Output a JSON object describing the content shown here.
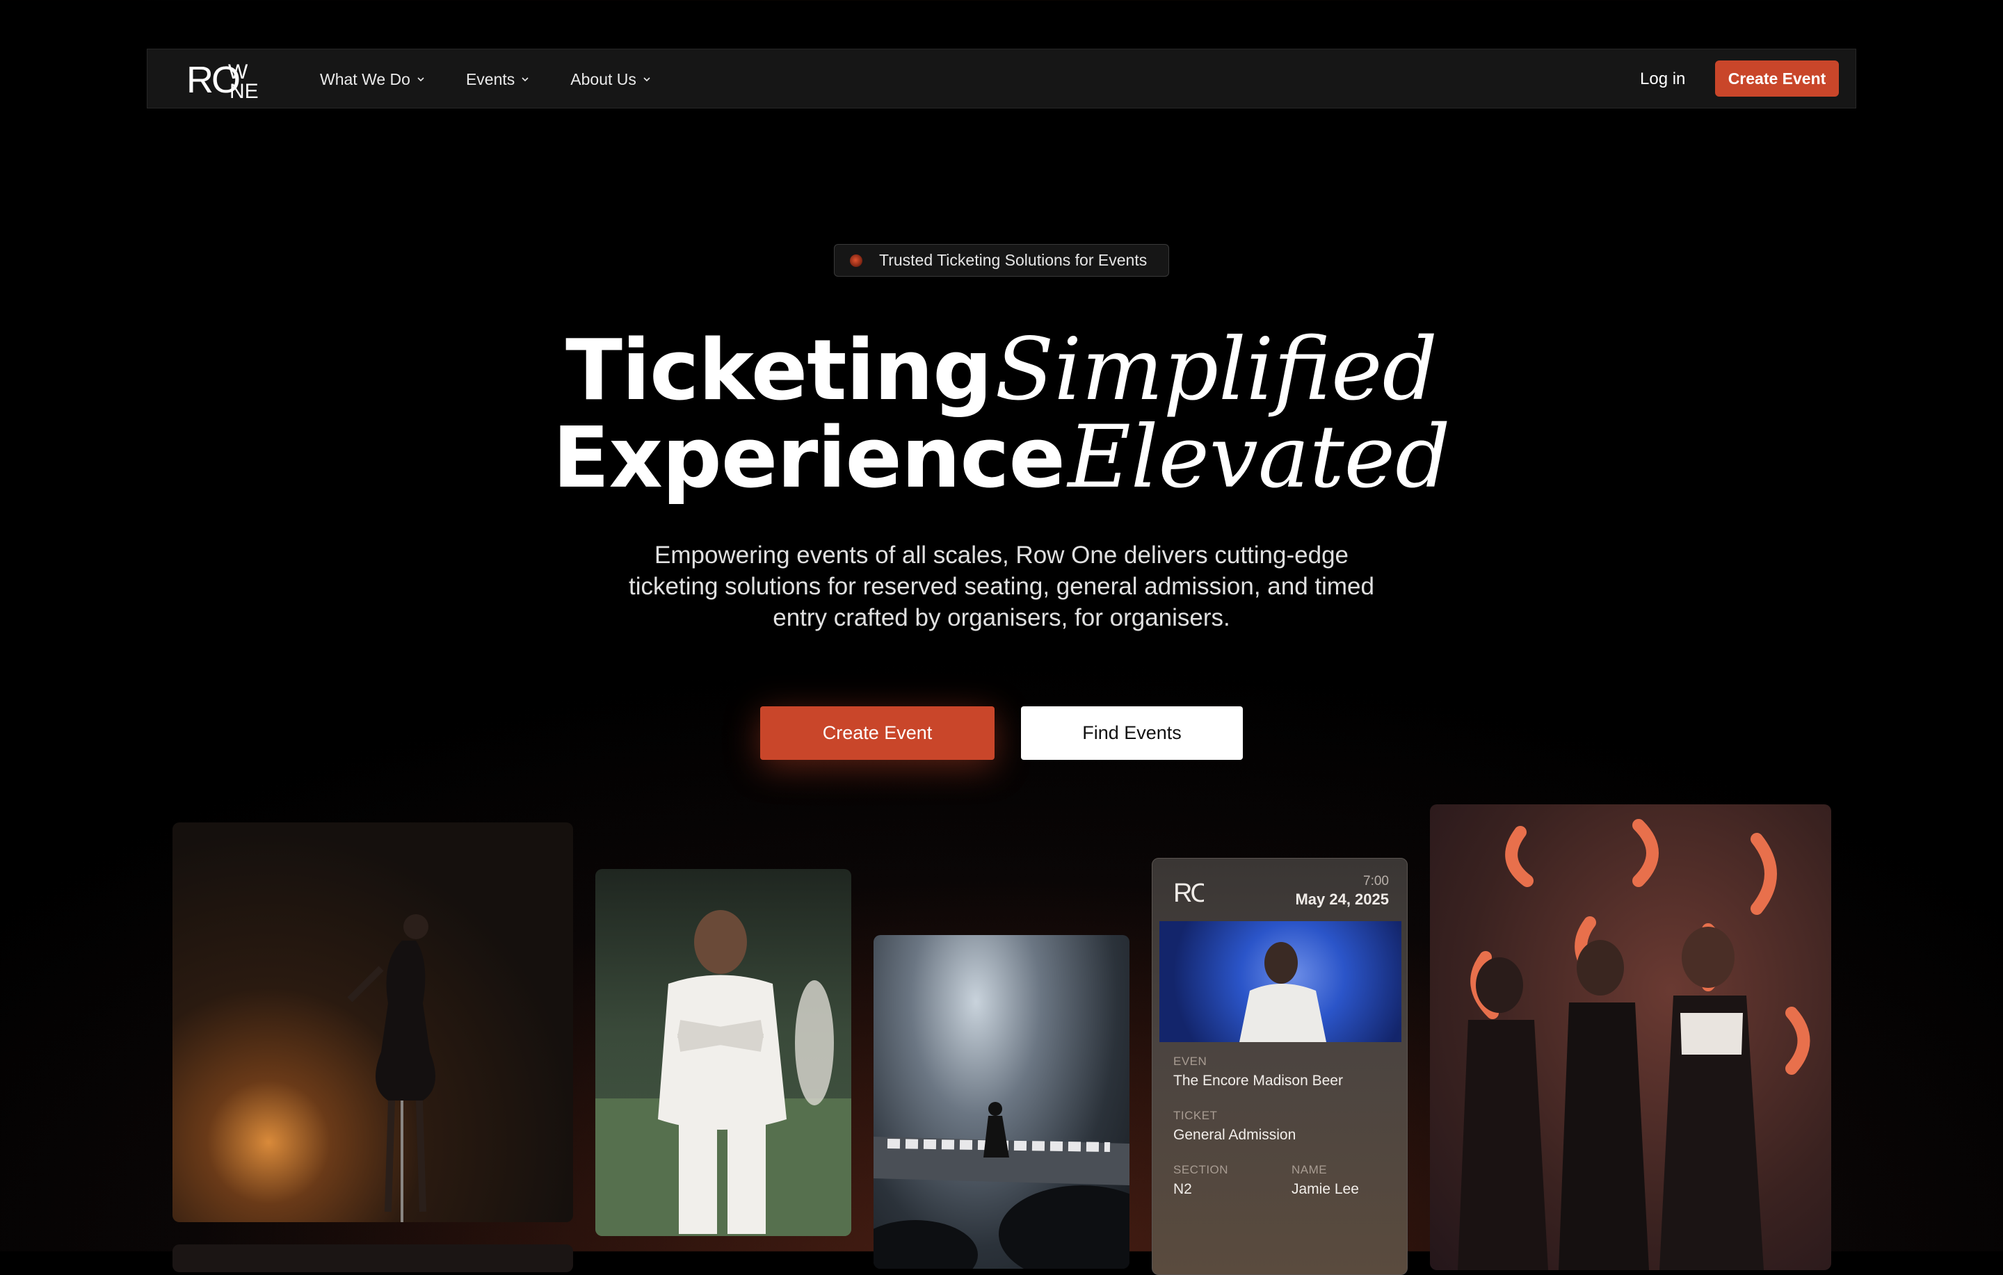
{
  "nav": {
    "logo_text": "ROWONE",
    "menu": [
      {
        "label": "What We Do"
      },
      {
        "label": "Events"
      },
      {
        "label": "About Us"
      }
    ],
    "login_label": "Log in",
    "cta_label": "Create Event"
  },
  "hero": {
    "badge": "Trusted Ticketing Solutions for Events",
    "line1_sans": "Ticketing",
    "line1_serif": "Simplified",
    "line2_sans": "Experience",
    "line2_serif": "Elevated",
    "subtitle": "Empowering events of all scales, Row One delivers cutting-edge ticketing solutions for reserved seating, general admission, and timed entry crafted by organisers, for organisers.",
    "primary_cta": "Create Event",
    "secondary_cta": "Find Events"
  },
  "ticket": {
    "logo": "RO",
    "time": "7:00",
    "date": "May 24, 2025",
    "event_label": "EVEN",
    "event_value": "The Encore Madison Beer",
    "ticket_label": "TICKET",
    "ticket_value": "General Admission",
    "section_label": "SECTION",
    "section_value": "N2",
    "name_label": "NAME",
    "name_value": "Jamie Lee"
  },
  "colors": {
    "accent": "#c9462a",
    "background": "#000000",
    "nav_bg": "#161616"
  }
}
